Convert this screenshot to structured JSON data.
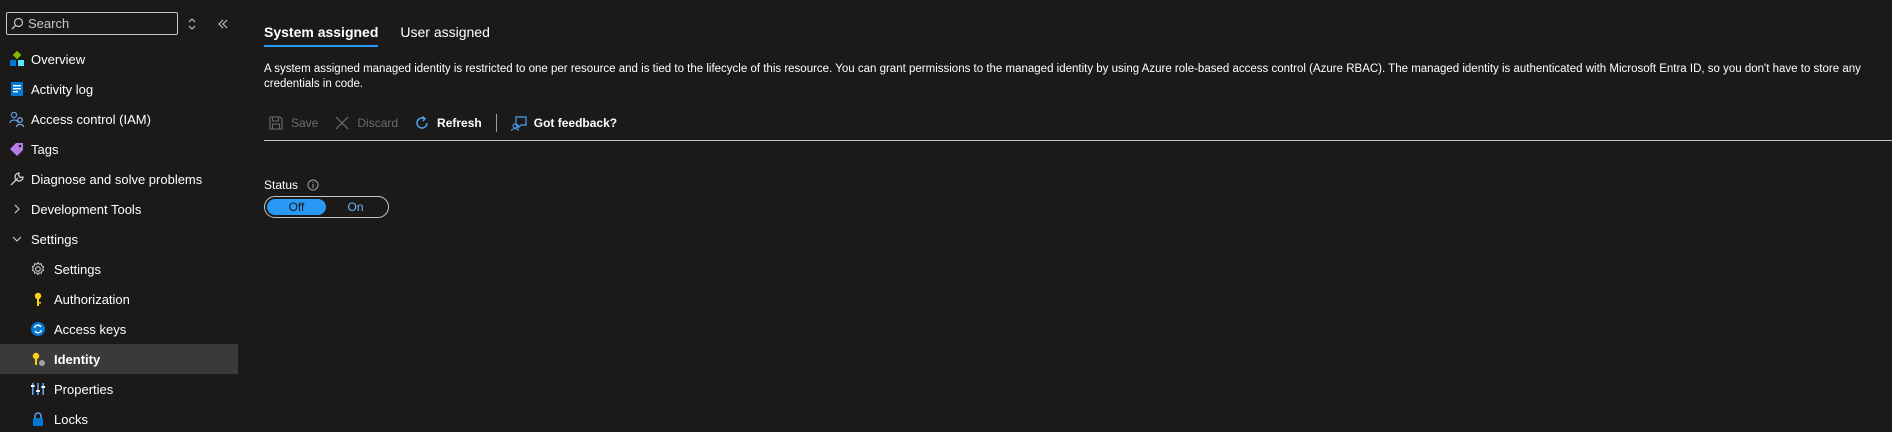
{
  "search": {
    "placeholder": "Search"
  },
  "sidebar": {
    "items": [
      {
        "label": "Overview",
        "icon": "overview-icon"
      },
      {
        "label": "Activity log",
        "icon": "activity-log-icon"
      },
      {
        "label": "Access control (IAM)",
        "icon": "iam-icon"
      },
      {
        "label": "Tags",
        "icon": "tag-icon"
      },
      {
        "label": "Diagnose and solve problems",
        "icon": "wrench-icon"
      },
      {
        "label": "Development Tools",
        "icon": "chevron-right-icon"
      },
      {
        "label": "Settings",
        "icon": "chevron-down-icon"
      },
      {
        "label": "Settings",
        "icon": "gear-icon"
      },
      {
        "label": "Authorization",
        "icon": "key-icon"
      },
      {
        "label": "Access keys",
        "icon": "access-keys-icon"
      },
      {
        "label": "Identity",
        "icon": "identity-icon"
      },
      {
        "label": "Properties",
        "icon": "properties-icon"
      },
      {
        "label": "Locks",
        "icon": "lock-icon"
      }
    ],
    "active_index": 10
  },
  "tabs": [
    {
      "label": "System assigned",
      "active": true
    },
    {
      "label": "User assigned",
      "active": false
    }
  ],
  "description": "A system assigned managed identity is restricted to one per resource and is tied to the lifecycle of this resource. You can grant permissions to the managed identity by using Azure role-based access control (Azure RBAC). The managed identity is authenticated with Microsoft Entra ID, so you don't have to store any credentials in code.",
  "toolbar": {
    "save_label": "Save",
    "discard_label": "Discard",
    "refresh_label": "Refresh",
    "feedback_label": "Got feedback?"
  },
  "status": {
    "label": "Status",
    "options": [
      "Off",
      "On"
    ],
    "selected": "Off"
  },
  "colors": {
    "background": "#1b1a19",
    "accent": "#2899f5",
    "active_item": "#3b3a39"
  }
}
